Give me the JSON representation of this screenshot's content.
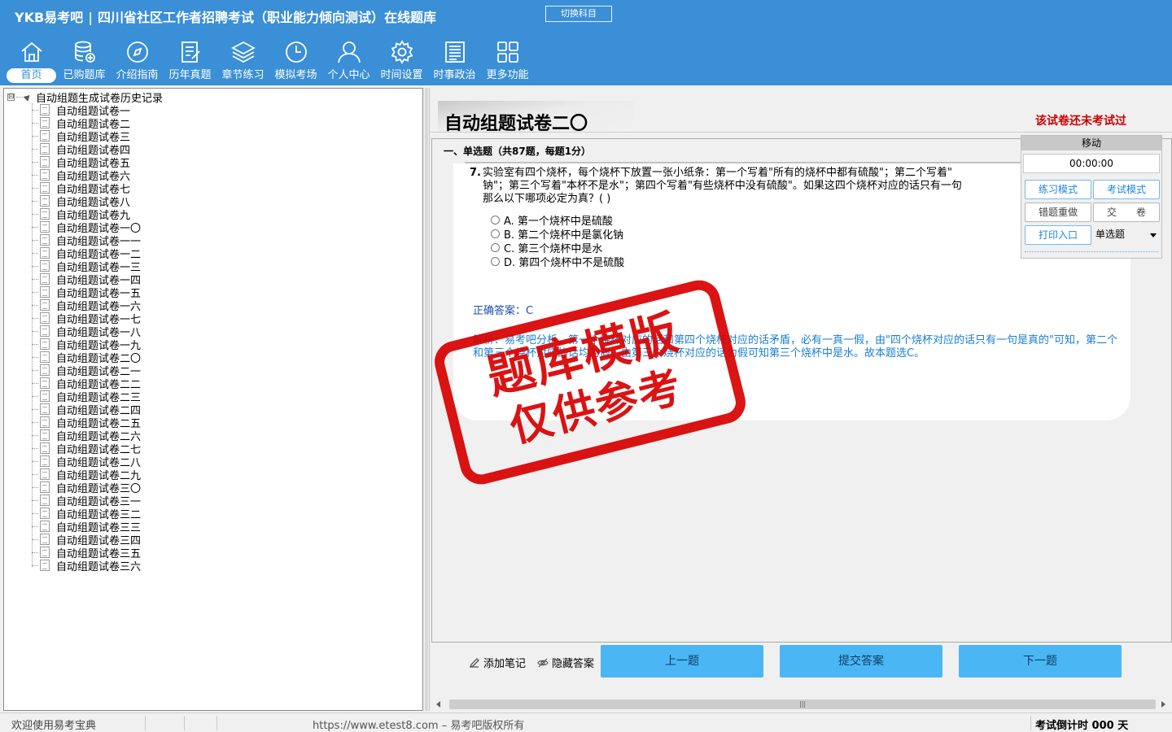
{
  "header": {
    "brand": "YKB易考吧",
    "separator": "|",
    "title": "四川省社区工作者招聘考试（职业能力倾向测试）在线题库",
    "switch_label": "切换科目",
    "bg_color": "#3a8fd6"
  },
  "nav": [
    {
      "label": "首页",
      "icon": "home-icon"
    },
    {
      "label": "已购题库",
      "icon": "database-icon"
    },
    {
      "label": "介绍指南",
      "icon": "compass-icon"
    },
    {
      "label": "历年真题",
      "icon": "document-icon"
    },
    {
      "label": "章节练习",
      "icon": "layers-icon"
    },
    {
      "label": "模拟考场",
      "icon": "clock-icon"
    },
    {
      "label": "个人中心",
      "icon": "user-icon"
    },
    {
      "label": "时间设置",
      "icon": "gear-icon"
    },
    {
      "label": "时事政治",
      "icon": "news-icon"
    },
    {
      "label": "更多功能",
      "icon": "grid-icon"
    }
  ],
  "tree": {
    "expander": "⊟",
    "root": "自动组题生成试卷历史记录",
    "items": [
      "自动组题试卷一",
      "自动组题试卷二",
      "自动组题试卷三",
      "自动组题试卷四",
      "自动组题试卷五",
      "自动组题试卷六",
      "自动组题试卷七",
      "自动组题试卷八",
      "自动组题试卷九",
      "自动组题试卷一〇",
      "自动组题试卷一一",
      "自动组题试卷一二",
      "自动组题试卷一三",
      "自动组题试卷一四",
      "自动组题试卷一五",
      "自动组题试卷一六",
      "自动组题试卷一七",
      "自动组题试卷一八",
      "自动组题试卷一九",
      "自动组题试卷二〇",
      "自动组题试卷二一",
      "自动组题试卷二二",
      "自动组题试卷二三",
      "自动组题试卷二四",
      "自动组题试卷二五",
      "自动组题试卷二六",
      "自动组题试卷二七",
      "自动组题试卷二八",
      "自动组题试卷二九",
      "自动组题试卷三〇",
      "自动组题试卷三一",
      "自动组题试卷三二",
      "自动组题试卷三三",
      "自动组题试卷三四",
      "自动组题试卷三五",
      "自动组题试卷三六"
    ]
  },
  "paper": {
    "title": "自动组题试卷二〇",
    "status": "该试卷还未考试过",
    "section": "一、单选题（共87题，每题1分）"
  },
  "question": {
    "number": "7.",
    "text": "实验室有四个烧杯，每个烧杯下放置一张小纸条：第一个写着\"所有的烧杯中都有硫酸\"；第二个写着\"\n钠\"；第三个写着\"本杯不是水\"；第四个写着\"有些烧杯中没有硫酸\"。如果这四个烧杯对应的话只有一句\n那么以下哪项必定为真？( )",
    "options": [
      "A. 第一个烧杯中是硫酸",
      "B. 第二个烧杯中是氯化钠",
      "C. 第三个烧杯中是水",
      "D. 第四个烧杯中不是硫酸"
    ],
    "answer_label": "正确答案：",
    "answer": "C",
    "analysis": "解析：易考吧分析，第一个烧杯对应的话和第四个烧杯对应的话矛盾，必有一真一假，由\"四个烧杯对应的话只有一句是真的\"可知，第二个和第三个烧杯对应的话均为假，由第三个烧杯对应的话为假可知第三个烧杯中是水。故本题选C。"
  },
  "stamp": {
    "line1": "题库模版",
    "line2": "仅供参考",
    "color": "#d80000"
  },
  "control": {
    "move": "移动",
    "timer": "00:00:00",
    "practice_mode": "练习模式",
    "exam_mode": "考试模式",
    "redo_wrong": "错题重做",
    "submit_paper": "交　　卷",
    "print": "打印入口",
    "qtype": "单选题"
  },
  "bottom": {
    "add_note": "添加笔记",
    "hide_answer": "隐藏答案",
    "prev": "上一题",
    "submit": "提交答案",
    "next": "下一题",
    "button_color": "#4ab7f4"
  },
  "status": {
    "welcome": "欢迎使用易考宝典",
    "copyright": "https://www.etest8.com – 易考吧版权所有",
    "countdown": "考试倒计时 000 天"
  }
}
